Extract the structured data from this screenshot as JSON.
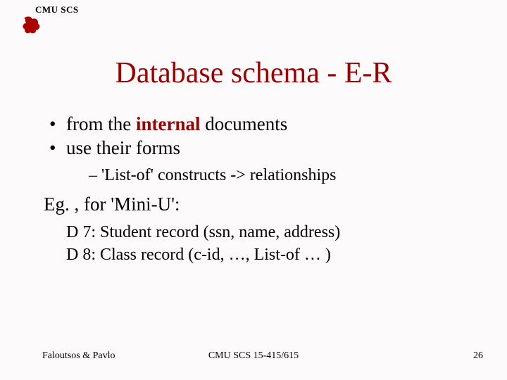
{
  "header": {
    "label": "CMU SCS"
  },
  "title": "Database schema - E-R",
  "bullets": {
    "b1_pre": "from the ",
    "b1_em": "internal",
    "b1_post": " documents",
    "b2": "use their forms"
  },
  "sub": {
    "s1": "– 'List-of' constructs -> relationships"
  },
  "eg": "Eg. , for 'Mini-U':",
  "docs": {
    "d1": "D 7: Student record (ssn, name, address)",
    "d2": "D 8: Class record (c-id, …, List-of … )"
  },
  "footer": {
    "left": "Faloutsos & Pavlo",
    "center": "CMU SCS 15-415/615",
    "right": "26"
  }
}
